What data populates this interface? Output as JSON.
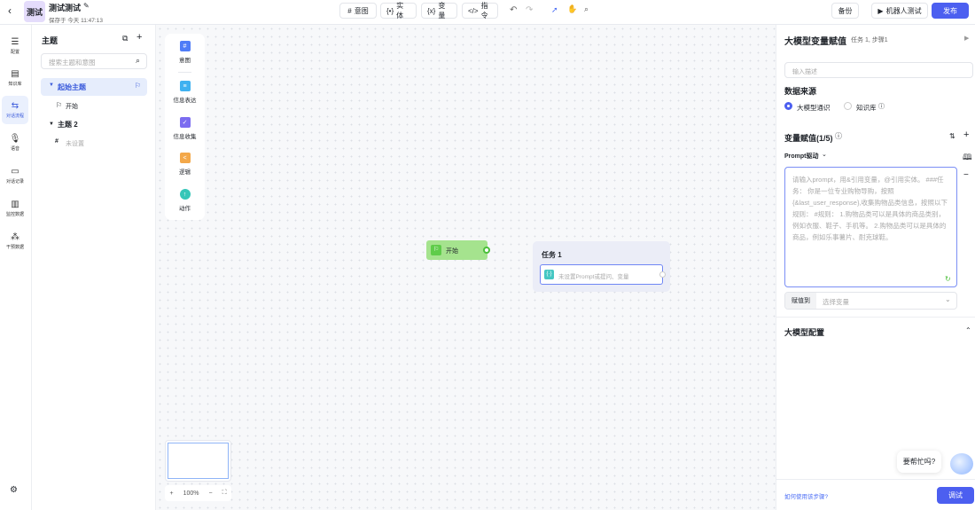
{
  "header": {
    "app_badge": "测试",
    "title": "测试测试",
    "saved": "保存于 今天 11:47:13",
    "tools": [
      {
        "icon": "hash-icon",
        "label": "意图"
      },
      {
        "icon": "entity-icon",
        "label": "实体"
      },
      {
        "icon": "variable-icon",
        "label": "变量"
      },
      {
        "icon": "code-icon",
        "label": "指令"
      }
    ],
    "backup": "备份",
    "robot_test": "机器人测试",
    "publish": "发布"
  },
  "nav": [
    {
      "icon": "sliders-icon",
      "label": "配置"
    },
    {
      "icon": "book-icon",
      "label": "知识库"
    },
    {
      "icon": "flow-icon",
      "label": "对话流程",
      "active": true
    },
    {
      "icon": "microphone-icon",
      "label": "语音"
    },
    {
      "icon": "chat-record-icon",
      "label": "对话记录"
    },
    {
      "icon": "chart-icon",
      "label": "监控数据"
    },
    {
      "icon": "cluster-icon",
      "label": "干预数据"
    }
  ],
  "topics": {
    "title": "主题",
    "search_placeholder": "搜索主题和意图",
    "tree": [
      {
        "label": "起始主题",
        "selected": true,
        "children": [
          {
            "icon": "flag-icon",
            "label": "开始"
          }
        ]
      },
      {
        "label": "主题 2",
        "children": [
          {
            "icon": "hash-icon",
            "label": "未设置"
          }
        ]
      }
    ]
  },
  "palette": [
    {
      "label": "意图",
      "color": "#4f7cf7",
      "glyph": "#"
    },
    {
      "label": "信息表达",
      "color": "#3fb1f0",
      "glyph": "≡"
    },
    {
      "label": "信息收集",
      "color": "#7b6cf0",
      "glyph": "✓"
    },
    {
      "label": "逻辑",
      "color": "#f3a84a",
      "glyph": "<"
    },
    {
      "label": "动作",
      "color": "#35c6b8",
      "glyph": "↑"
    }
  ],
  "canvas": {
    "start_node": "开始",
    "task_title": "任务 1",
    "task_step": "未设置Prompt或提问、变量",
    "zoom": "100%"
  },
  "panel": {
    "title": "大模型变量赋值",
    "subtitle": "任务 1, 步骤1",
    "desc_placeholder": "输入描述",
    "source_title": "数据来源",
    "sources": [
      {
        "label": "大模型通识",
        "checked": true
      },
      {
        "label": "知识库",
        "checked": false
      }
    ],
    "var_title": "变量赋值(1/5)",
    "mode": "Prompt驱动",
    "prompt_placeholder": "请输入prompt，用&引用变量，@引用实体。 ###任务： 你是一位专业购物导购，按照{&last_user_response},收集购物品类信息，按照以下规则： #规则： 1.购物品类可以是具体的商品类别，例如衣服、鞋子、手机等。 2.购物品类可以是具体的商品，例如乐事薯片、耐克球鞋。",
    "assign_label": "赋值到",
    "assign_placeholder": "选择变量",
    "llm_config": "大模型配置",
    "help_link": "如何使用该步骤?",
    "debug": "调试",
    "assistant_bubble": "要帮忙吗?"
  },
  "colors": {
    "accent": "#4c5ff0",
    "start_green": "#a5e38e"
  }
}
